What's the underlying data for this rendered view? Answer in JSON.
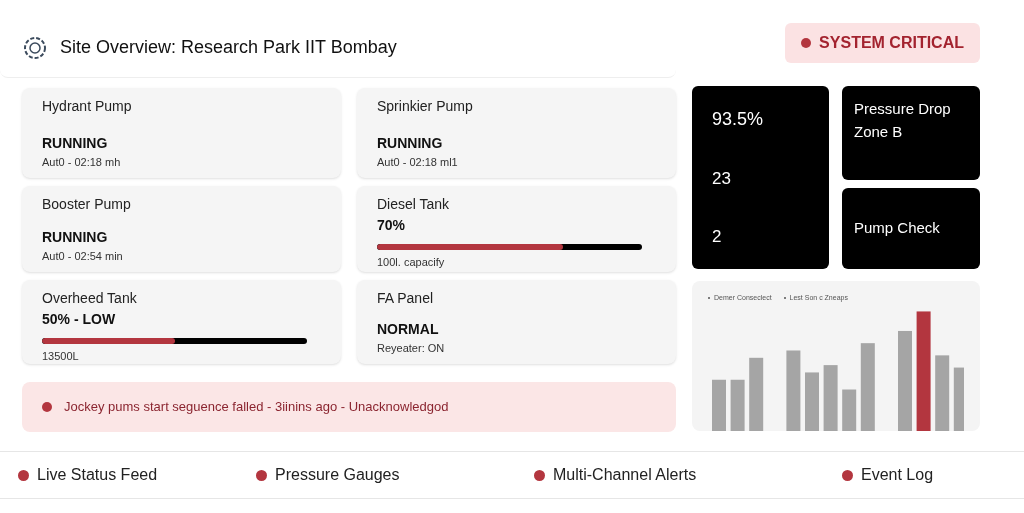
{
  "header": {
    "title": "Site Overview: Research Park IIT Bombay",
    "badge": "SYSTEM CRITICAL"
  },
  "cards": [
    {
      "kind": "status",
      "title": "Hydrant Pump",
      "status": "RUNNING",
      "detail": "Aut0 - 02:18 mh"
    },
    {
      "kind": "status",
      "title": "Sprinkier Pump",
      "status": "RUNNING",
      "detail": "Aut0 - 02:18 ml1"
    },
    {
      "kind": "status",
      "title": "Booster Pump",
      "status": "RUNNING",
      "detail": "Aut0 - 02:54 min"
    },
    {
      "kind": "gauge",
      "title": "Diesel Tank",
      "value": "70%",
      "level": 0.7,
      "detail": "100l. capacify"
    },
    {
      "kind": "gauge",
      "title": "Overheed Tank",
      "value": "50% - LOW",
      "level": 0.5,
      "detail": "13500L"
    },
    {
      "kind": "status",
      "title": "FA Panel",
      "status": "NORMAL",
      "detail": "Reyeater: ON"
    }
  ],
  "alert": "Jockey pums start seguence falled - 3iinins ago - Unacknowledgod",
  "metrics": [
    "93.5%",
    "23",
    "2"
  ],
  "tiles": [
    "Pressure Drop Zone B",
    "Pump Check"
  ],
  "chart_legend": [
    "Demer Conseclect",
    "Lest Son c Zneaps"
  ],
  "footer": [
    "Live Status Feed",
    "Pressure Gauges",
    "Multi-Channel Alerts",
    "Event Log"
  ]
}
